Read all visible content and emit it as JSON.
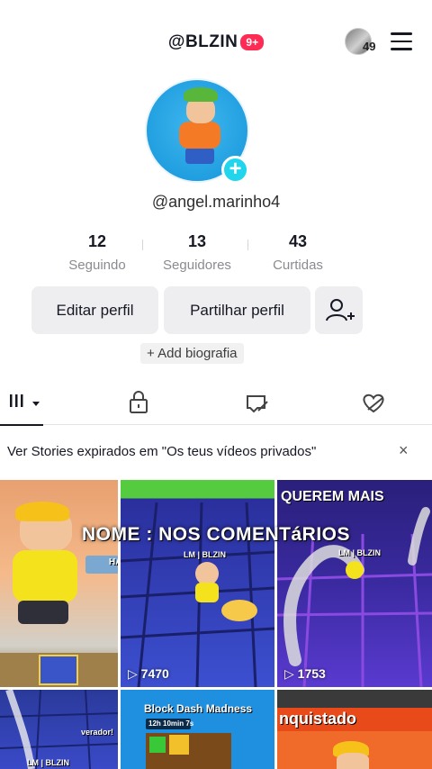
{
  "header": {
    "username": "@BLZIN",
    "notification_badge": "9+",
    "avatar_count": "49"
  },
  "profile": {
    "handle": "@angel.marinho4",
    "stats": [
      {
        "value": "12",
        "label": "Seguindo"
      },
      {
        "value": "13",
        "label": "Seguidores"
      },
      {
        "value": "43",
        "label": "Curtidas"
      }
    ],
    "edit_button": "Editar perfil",
    "share_button": "Partilhar perfil",
    "bio_button": "+ Add biografia"
  },
  "tabs": [
    "videos-grid-icon",
    "lock-icon",
    "tagged-icon",
    "liked-hidden-icon"
  ],
  "stories_notice": {
    "text": "Ver Stories expirados em \"Os teus vídeos privados\"",
    "close": "×"
  },
  "grid": {
    "overlay_text": "NOME : NOS COMENTáRIOS",
    "videos": [
      {
        "views": "",
        "label": "HA"
      },
      {
        "views": "7470",
        "label": "LM | BLZIN"
      },
      {
        "views": "1753",
        "label": "LM | BLZIN",
        "title": "QUEREM MAIS"
      },
      {
        "views": "",
        "label": "LM | BLZIN",
        "title": "verador!"
      },
      {
        "views": "",
        "title": "Block Dash Madness",
        "subtitle": "12h 10min 7s"
      },
      {
        "views": "",
        "title": "nquistado"
      }
    ]
  },
  "colors": {
    "accent": "#fe2c55",
    "plus": "#20d5ec",
    "button_bg": "#eeeef0"
  }
}
